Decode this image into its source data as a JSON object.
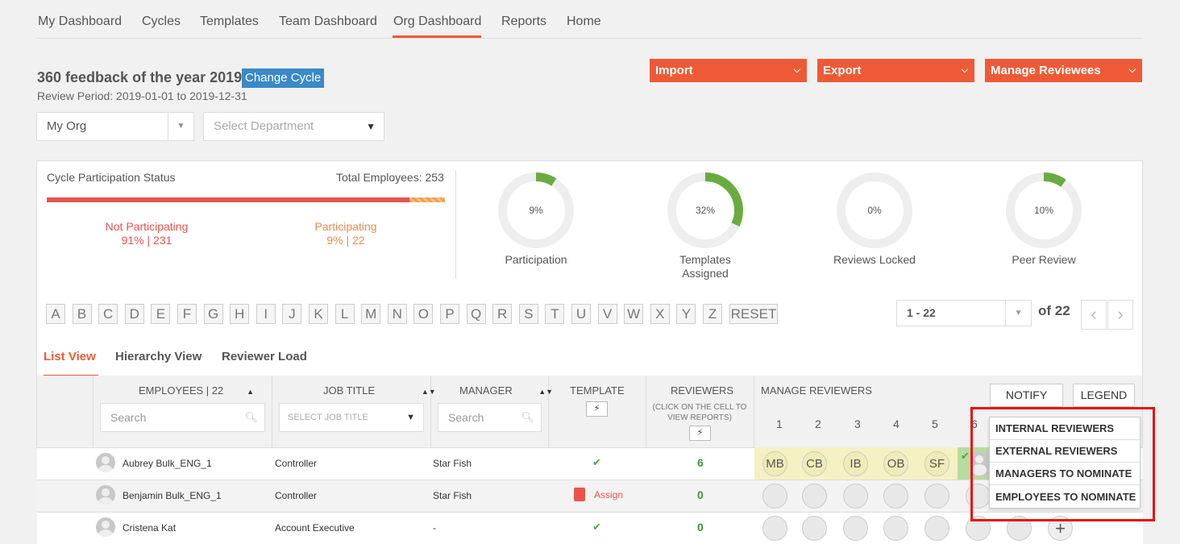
{
  "nav": {
    "items": [
      "My Dashboard",
      "Cycles",
      "Templates",
      "Team Dashboard",
      "Org Dashboard",
      "Reports",
      "Home"
    ],
    "active": "Org Dashboard"
  },
  "cycle": {
    "title": "360 feedback of the year 2019",
    "change_label": "Change Cycle",
    "period": "Review Period: 2019-01-01 to 2019-12-31"
  },
  "actions": {
    "import": "Import",
    "export": "Export",
    "manage_reviewees": "Manage Reviewees"
  },
  "filters": {
    "org_value": "My Org",
    "department_placeholder": "Select Department"
  },
  "participation": {
    "title": "Cycle Participation Status",
    "total": "Total Employees: 253",
    "not_participating_label": "Not Participating",
    "not_participating_value": "91% | 231",
    "participating_label": "Participating",
    "participating_value": "9% | 22",
    "not_participating_fraction": 0.91
  },
  "donuts": [
    {
      "label": "9%",
      "caption": "Participation",
      "fraction": 0.09
    },
    {
      "label": "32%",
      "caption": "Templates Assigned",
      "fraction": 0.32
    },
    {
      "label": "0%",
      "caption": "Reviews Locked",
      "fraction": 0.0
    },
    {
      "label": "10%",
      "caption": "Peer Review",
      "fraction": 0.1
    }
  ],
  "alphabet": [
    "A",
    "B",
    "C",
    "D",
    "E",
    "F",
    "G",
    "H",
    "I",
    "J",
    "K",
    "L",
    "M",
    "N",
    "O",
    "P",
    "Q",
    "R",
    "S",
    "T",
    "U",
    "V",
    "W",
    "X",
    "Y",
    "Z"
  ],
  "reset_label": "RESET",
  "pager": {
    "range": "1 - 22",
    "of": "of 22"
  },
  "tabs": [
    "List View",
    "Hierarchy View",
    "Reviewer Load"
  ],
  "table": {
    "col_employees": "EMPLOYEES | 22",
    "col_job_title": "JOB TITLE",
    "col_manager": "MANAGER",
    "col_template": "TEMPLATE",
    "col_reviewers": "REVIEWERS",
    "reviewers_hint": "(CLICK ON THE CELL TO VIEW REPORTS)",
    "col_manage": "MANAGE REVIEWERS",
    "search_placeholder": "Search",
    "job_title_placeholder": "SELECT JOB TITLE",
    "reviewer_numbers": [
      "1",
      "2",
      "3",
      "4",
      "5",
      "6"
    ],
    "notify": "NOTIFY",
    "legend": "LEGEND",
    "rows": [
      {
        "name": "Aubrey Bulk_ENG_1",
        "job": "Controller",
        "manager": "Star Fish",
        "template": "check",
        "reviewers": "6",
        "initials": [
          "MB",
          "CB",
          "IB",
          "OB",
          "SF"
        ]
      },
      {
        "name": "Benjamin Bulk_ENG_1",
        "job": "Controller",
        "manager": "Star Fish",
        "template": "Assign",
        "reviewers": "0",
        "initials": [
          "",
          "",
          "",
          "",
          ""
        ]
      },
      {
        "name": "Cristena Kat",
        "job": "Account Executive",
        "manager": "-",
        "template": "check",
        "reviewers": "0",
        "initials": [
          "",
          "",
          "",
          "",
          ""
        ]
      }
    ]
  },
  "dropdown": [
    "INTERNAL REVIEWERS",
    "EXTERNAL REVIEWERS",
    "MANAGERS TO NOMINATE",
    "EMPLOYEES TO NOMINATE"
  ],
  "colors": {
    "accent": "#ef5a36",
    "blue": "#3a89c9",
    "green": "#6aab3f",
    "red": "#e9534f",
    "highlight": "#e81010"
  }
}
